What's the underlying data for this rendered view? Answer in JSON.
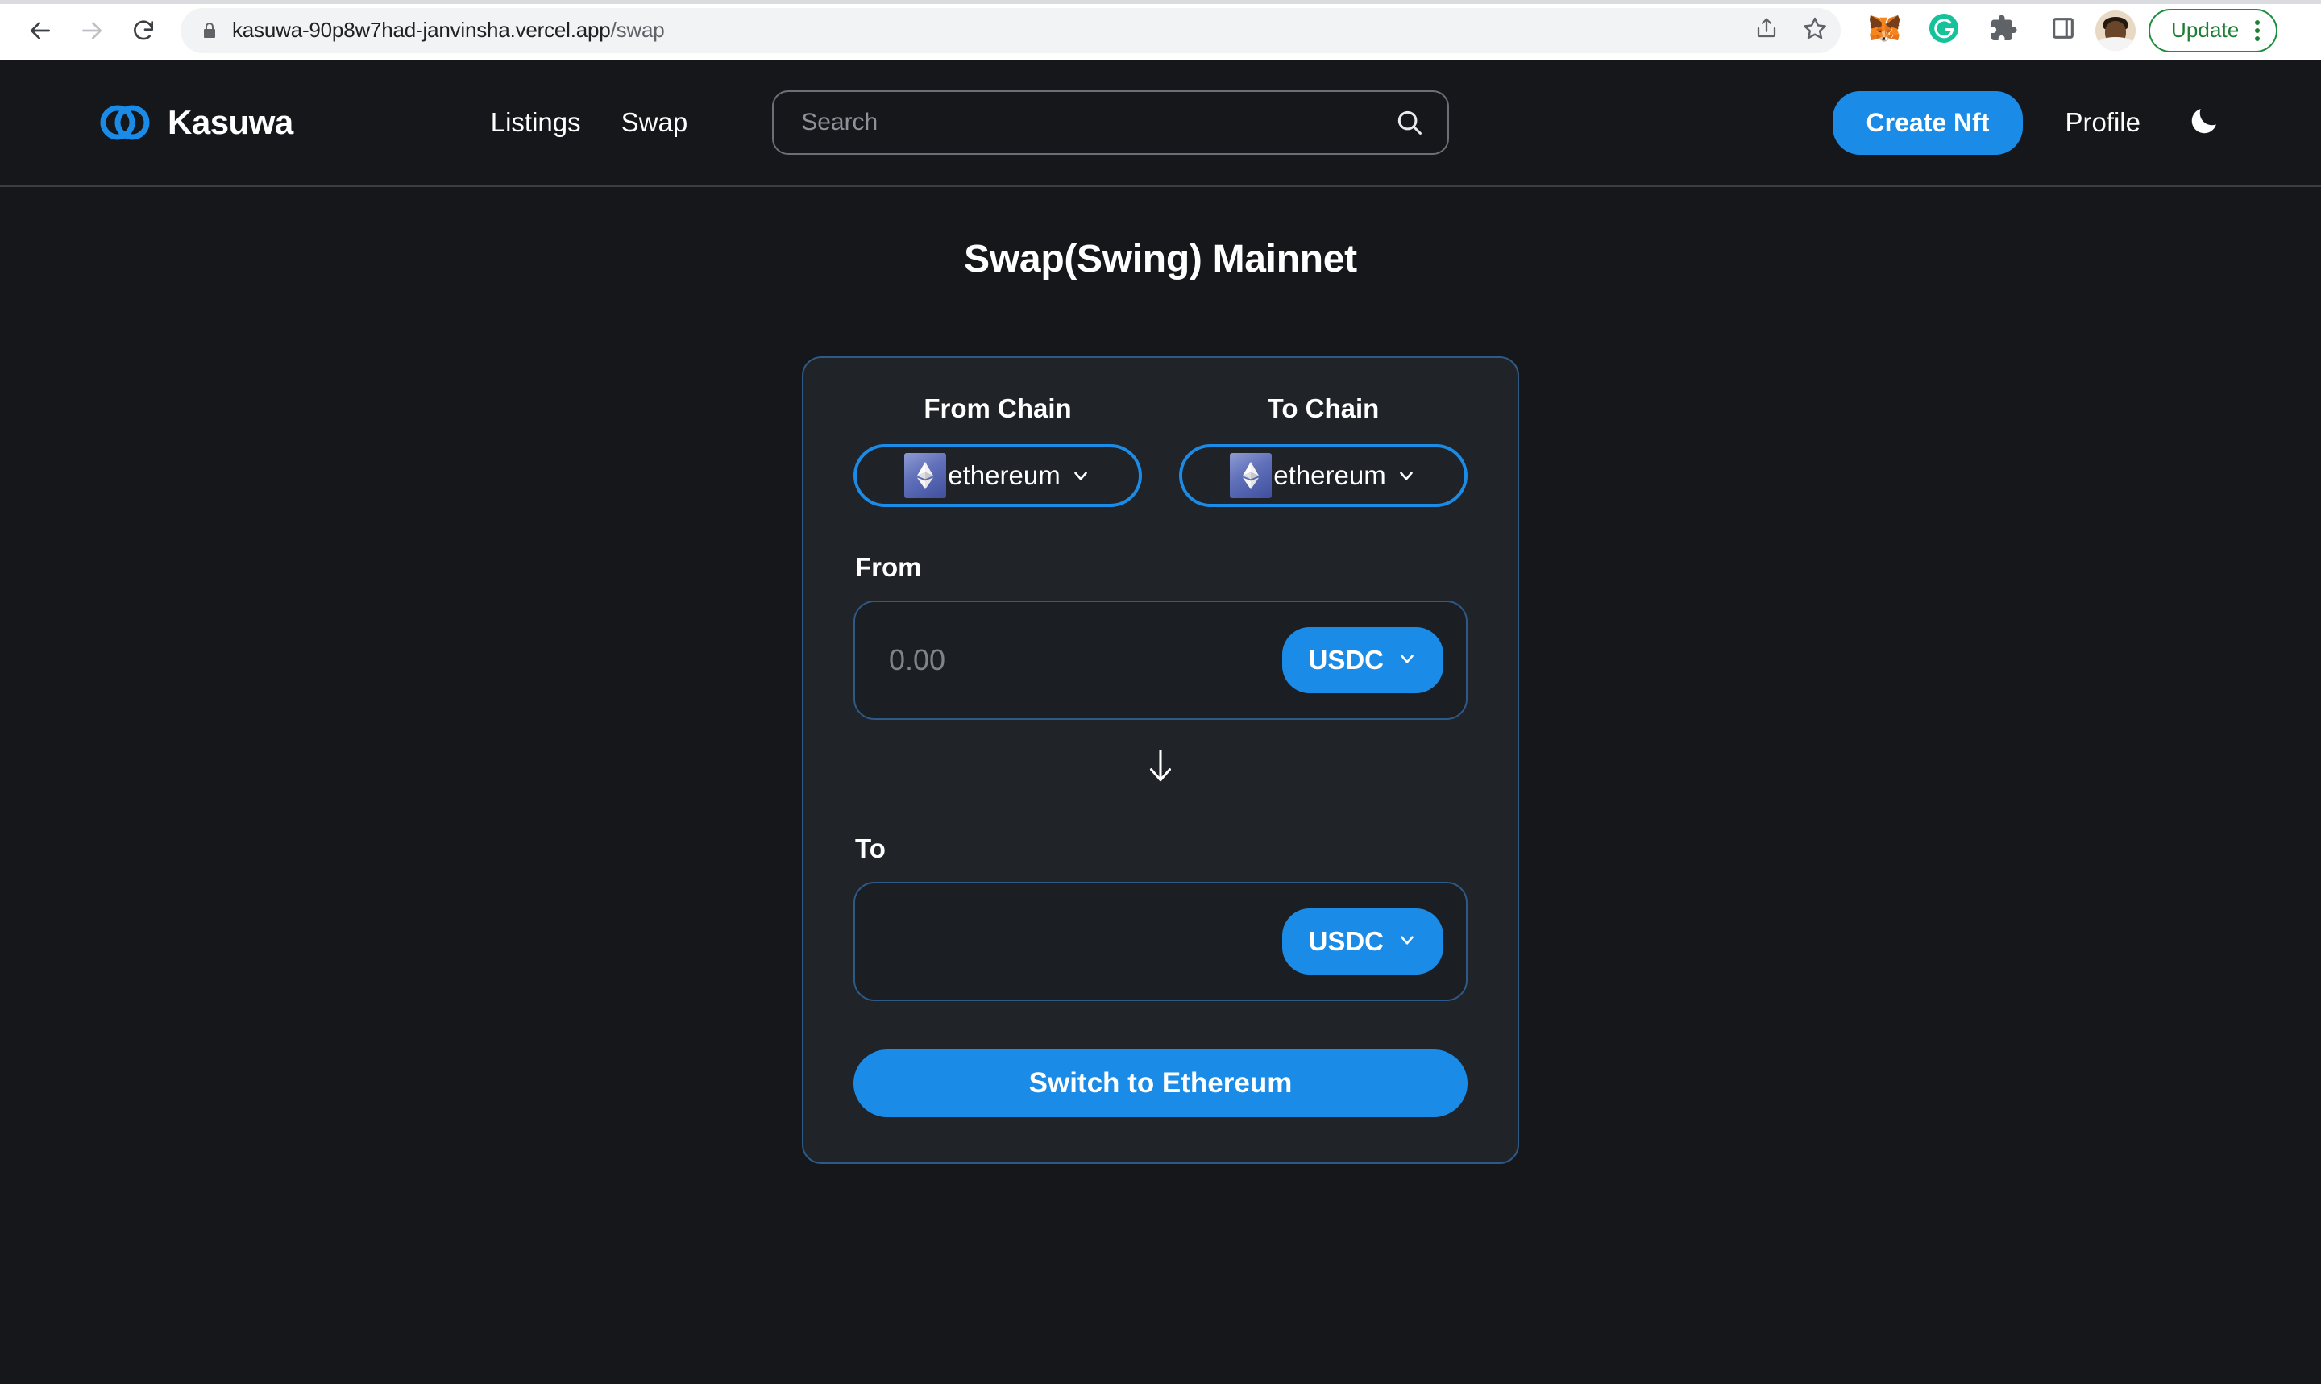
{
  "browser": {
    "url_host": "kasuwa-90p8w7had-janvinsha.vercel.app",
    "url_path": "/swap",
    "back_icon": "back-arrow-icon",
    "forward_icon": "forward-arrow-icon",
    "reload_icon": "reload-icon",
    "lock_icon": "lock-icon",
    "share_icon": "share-icon",
    "bookmark_icon": "star-icon",
    "metamask_icon": "metamask-fox-icon",
    "grammarly_icon": "grammarly-icon",
    "extensions_icon": "puzzle-piece-icon",
    "sidepanel_icon": "side-panel-icon",
    "avatar_icon": "profile-avatar",
    "update_label": "Update",
    "menu_icon": "kebab-menu-icon"
  },
  "header": {
    "brand_name": "Kasuwa",
    "logo_icon": "kasuwa-rings-logo",
    "nav": [
      {
        "label": "Listings"
      },
      {
        "label": "Swap"
      }
    ],
    "search": {
      "placeholder": "Search",
      "value": "",
      "icon": "search-icon"
    },
    "create_nft_label": "Create Nft",
    "profile_label": "Profile",
    "theme_toggle_icon": "moon-icon"
  },
  "main": {
    "title": "Swap(Swing) Mainnet",
    "from_chain": {
      "label": "From Chain",
      "value": "ethereum",
      "icon": "ethereum-icon",
      "chevron": "chevron-down-icon"
    },
    "to_chain": {
      "label": "To Chain",
      "value": "ethereum",
      "icon": "ethereum-icon",
      "chevron": "chevron-down-icon"
    },
    "from_field": {
      "label": "From",
      "placeholder": "0.00",
      "value": "",
      "token": "USDC",
      "chevron": "chevron-down-icon"
    },
    "swap_arrow_icon": "arrow-down-icon",
    "to_field": {
      "label": "To",
      "placeholder": "",
      "value": "",
      "token": "USDC",
      "chevron": "chevron-down-icon"
    },
    "action_label": "Switch to Ethereum"
  },
  "colors": {
    "page_bg": "#15171b",
    "card_bg": "#202328",
    "accent_blue": "#1a8ce8",
    "card_border": "#2d5a86",
    "update_green": "#1e7e34"
  }
}
